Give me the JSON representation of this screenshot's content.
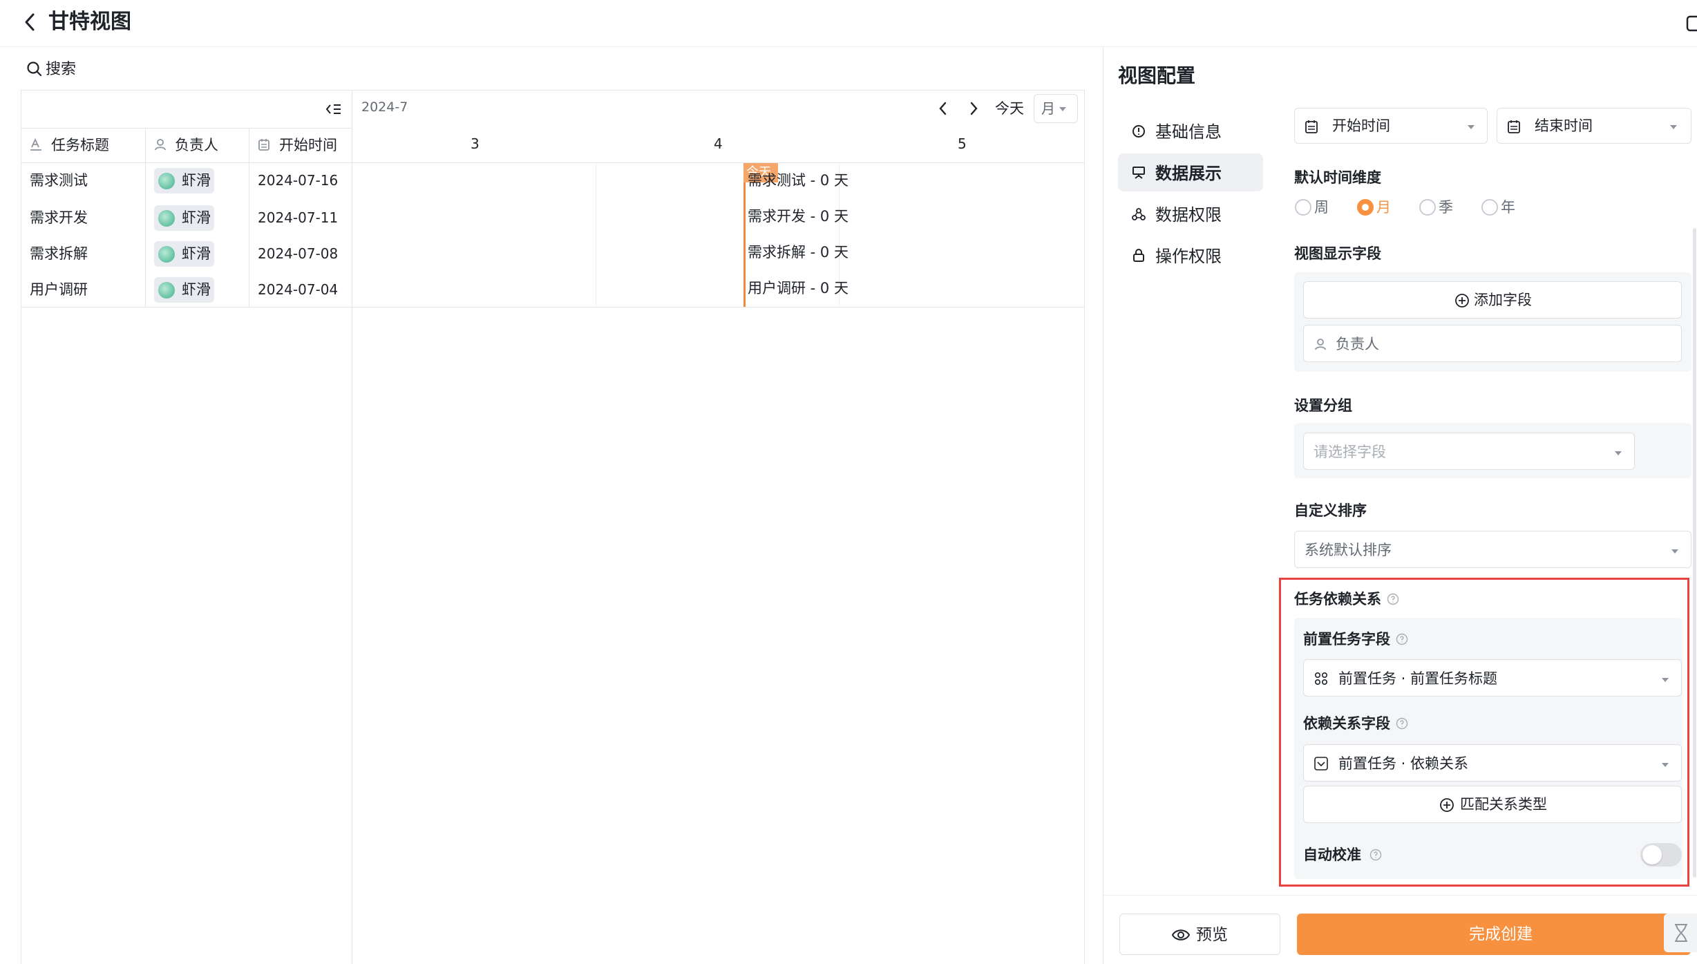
{
  "header": {
    "title": "甘特视图"
  },
  "search": {
    "label": "搜索"
  },
  "table": {
    "columns": [
      "任务标题",
      "负责人",
      "开始时间"
    ],
    "rows": [
      {
        "title": "需求测试",
        "owner": "虾滑",
        "start": "2024-07-16"
      },
      {
        "title": "需求开发",
        "owner": "虾滑",
        "start": "2024-07-11"
      },
      {
        "title": "需求拆解",
        "owner": "虾滑",
        "start": "2024-07-08"
      },
      {
        "title": "用户调研",
        "owner": "虾滑",
        "start": "2024-07-04"
      }
    ]
  },
  "gantt": {
    "month_label": "2024-7",
    "today_button": "今天",
    "scale_select": "月",
    "days": [
      "3",
      "4",
      "5"
    ],
    "today_marker": "今天",
    "bars": [
      "需求测试 - 0 天",
      "需求开发 - 0 天",
      "需求拆解 - 0 天",
      "用户调研 - 0 天"
    ]
  },
  "config": {
    "title": "视图配置",
    "menu": [
      "基础信息",
      "数据展示",
      "数据权限",
      "操作权限"
    ],
    "active_menu": "数据展示",
    "start_time_field": "开始时间",
    "end_time_field": "结束时间",
    "time_dimension": {
      "label": "默认时间维度",
      "options": [
        "周",
        "月",
        "季",
        "年"
      ],
      "selected": "月"
    },
    "display_fields": {
      "label": "视图显示字段",
      "add_button": "添加字段",
      "field": "负责人"
    },
    "group": {
      "label": "设置分组",
      "placeholder": "请选择字段"
    },
    "sort": {
      "label": "自定义排序",
      "value": "系统默认排序"
    },
    "dependency": {
      "label": "任务依赖关系",
      "pre_task_label": "前置任务字段",
      "pre_task_value": "前置任务 · 前置任务标题",
      "relation_label": "依赖关系字段",
      "relation_value": "前置任务 · 依赖关系",
      "match_button": "匹配关系类型",
      "auto_label": "自动校准",
      "auto_enabled": false
    },
    "preview_button": "预览",
    "create_button": "完成创建"
  },
  "colors": {
    "accent": "#f7913f",
    "today_line": "#f0883e",
    "highlight_border": "#e8423f",
    "active_menu_bg": "#eef0f3"
  }
}
